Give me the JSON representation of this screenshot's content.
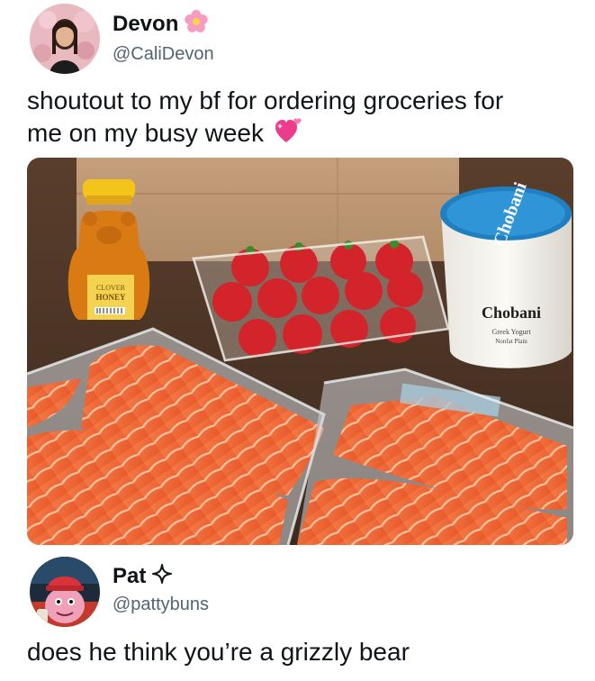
{
  "post": {
    "author": {
      "display_name": "Devon",
      "handle": "@CaliDevon",
      "badge_icon": "flower-emoji-icon"
    },
    "text": "shoutout to my bf for ordering groceries for me on my busy week",
    "emoji_icon": "sparkling-heart-icon",
    "media": {
      "honey_label_top": "CLOVER",
      "honey_label_bottom": "HONEY",
      "yogurt_brand": "Chobani",
      "yogurt_sub": "Greek Yogurt",
      "yogurt_sub2": "Nonfat Plain"
    }
  },
  "reply": {
    "author": {
      "display_name": "Pat",
      "handle": "@pattybuns",
      "badge_icon": "sparkle-icon"
    },
    "text": "does he think you’re a grizzly bear"
  },
  "colors": {
    "text": "#0f1419",
    "muted": "#536471",
    "salmon": "#f26b3a"
  }
}
